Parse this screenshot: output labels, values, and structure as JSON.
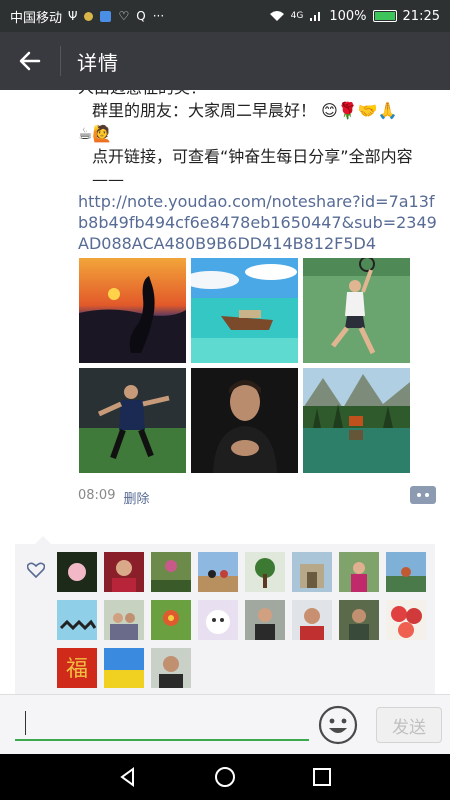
{
  "status": {
    "carrier": "中国移动",
    "network": "4G",
    "battery": "100%",
    "time": "21:25"
  },
  "header": {
    "title": "详情"
  },
  "post": {
    "top_partial": "人由迈感征的美！",
    "greeting": "群里的朋友：大家周二早晨好！",
    "instruction": "点开链接，可查看“钟奋生每日分享”全部内容——",
    "link": "http://note.youdao.com/noteshare?id=7a13fb8b49fb494cf6e8478eb1650447&sub=2349AD088ACA480B9B6DD414B812F5D4",
    "photos": [
      "sunset-heron",
      "longtail-boat",
      "tennis-player",
      "soccer-player",
      "man-portrait",
      "lake-cabins"
    ],
    "time": "08:09",
    "delete_label": "删除"
  },
  "likes": {
    "count": 19
  },
  "input": {
    "value": "",
    "send_label": "发送"
  },
  "colors": {
    "titlebar": "#393a3f",
    "link": "#576b95",
    "accent": "#3ba94d"
  }
}
